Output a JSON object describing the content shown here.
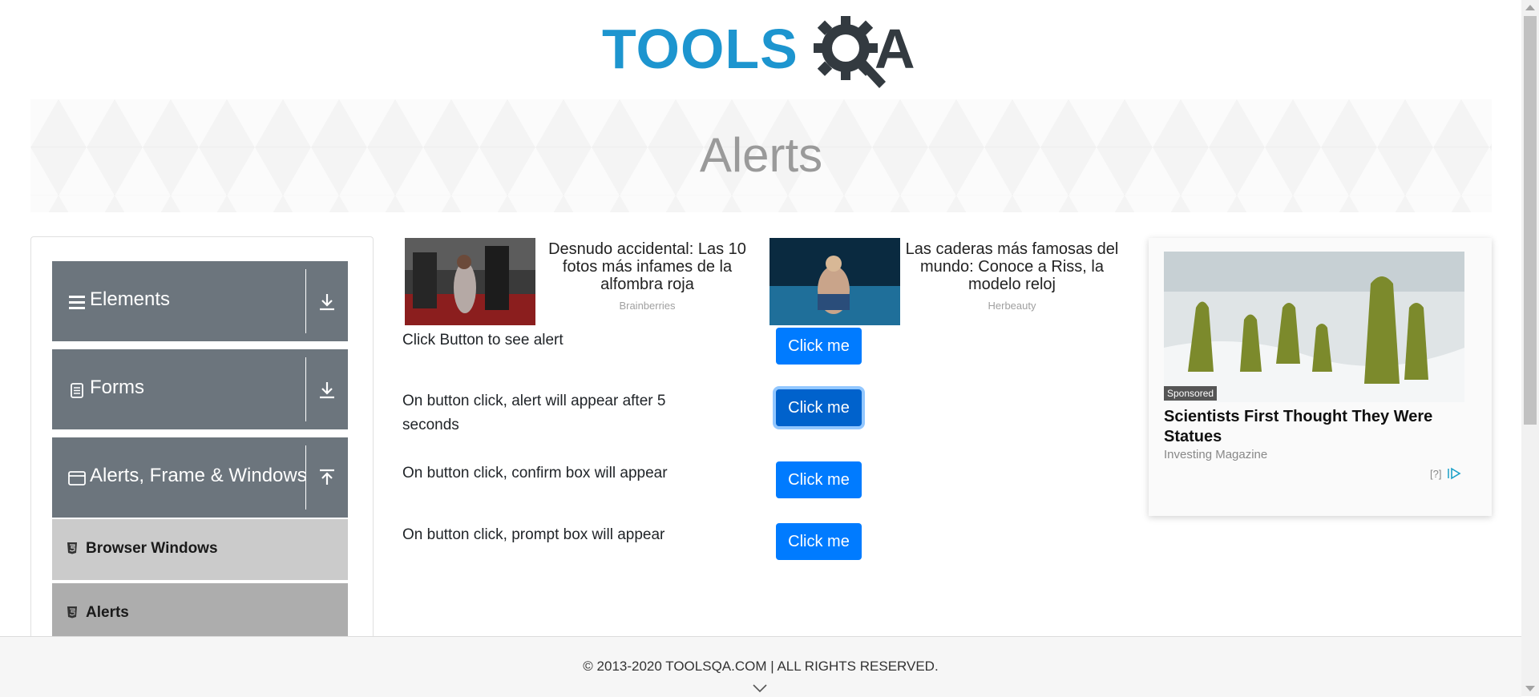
{
  "header": {
    "logo_word": "TOOLS",
    "logo_end": "A",
    "logo_alt": "TOOLSQA"
  },
  "banner": {
    "title": "Alerts"
  },
  "sidebar": {
    "groups": [
      {
        "label": "Elements",
        "icon": "hamburger-icon",
        "arrow": "download-icon"
      },
      {
        "label": "Forms",
        "icon": "document-icon",
        "arrow": "download-icon"
      },
      {
        "label": "Alerts, Frame & Windows",
        "icon": "window-icon",
        "arrow": "upload-icon"
      }
    ],
    "items": [
      {
        "label": "Browser Windows",
        "icon": "html5-icon"
      },
      {
        "label": "Alerts",
        "icon": "html5-icon"
      }
    ]
  },
  "ads": [
    {
      "title": "Desnudo accidental: Las 10 fotos más infames de la alfombra roja",
      "source": "Brainberries"
    },
    {
      "title": "Las caderas más famosas del mundo: Conoce a Riss, la modelo reloj",
      "source": "Herbeauty"
    }
  ],
  "alerts": [
    {
      "label": "Click Button to see alert",
      "button": "Click me"
    },
    {
      "label": "On button click, alert will appear after 5 seconds",
      "button": "Click me"
    },
    {
      "label": "On button click, confirm box will appear",
      "button": "Click me"
    },
    {
      "label": "On button click, prompt box will appear",
      "button": "Click me"
    }
  ],
  "sponsored": {
    "badge": "Sponsored",
    "title": "Scientists First Thought They Were Statues",
    "publisher": "Investing Magazine",
    "help": "[?]"
  },
  "footer": {
    "copyright": "© 2013-2020 TOOLSQA.COM | ALL RIGHTS RESERVED."
  },
  "colors": {
    "primary": "#007bff",
    "sidebar_group": "#6c757d",
    "logo_blue": "#1d95cf",
    "logo_dark": "#333a40"
  }
}
